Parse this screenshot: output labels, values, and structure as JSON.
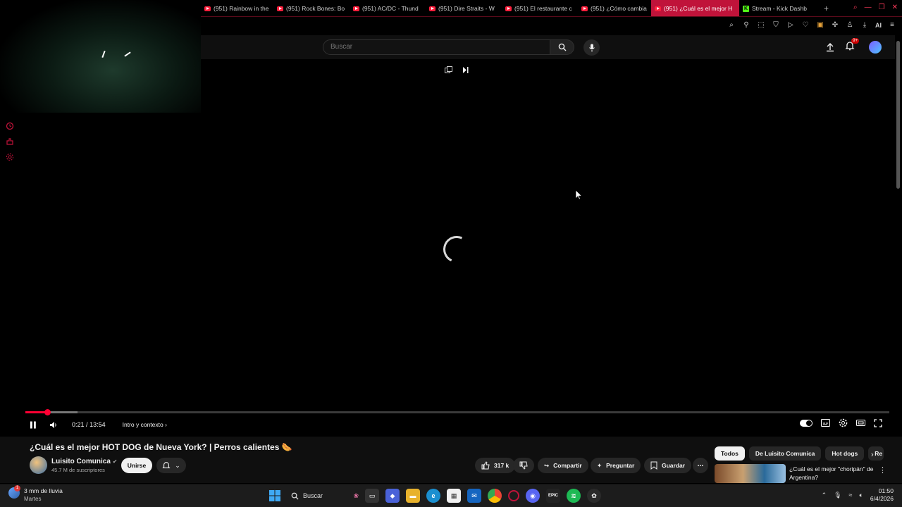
{
  "browser": {
    "tabs": [
      {
        "label": "(951) Rainbow in the",
        "type": "yt"
      },
      {
        "label": "(951) Rock Bones: Bo",
        "type": "yt"
      },
      {
        "label": "(951) AC/DC - Thund",
        "type": "yt"
      },
      {
        "label": "(951) Dire Straits - W",
        "type": "yt"
      },
      {
        "label": "(951) El restaurante c",
        "type": "yt"
      },
      {
        "label": "(951) ¿Cómo cambia",
        "type": "yt"
      },
      {
        "label": "(951) ¿Cuál es el mejor H",
        "type": "yt",
        "active": true
      },
      {
        "label": "Stream - Kick Dashb",
        "type": "kick"
      }
    ],
    "toolbar_ai": "AI",
    "accent": "#c0133a"
  },
  "youtube": {
    "search_placeholder": "Buscar",
    "notifications_badge": "9+"
  },
  "player": {
    "current_time": "0:21",
    "duration": "13:54",
    "time_separator": "/",
    "chapter": "Intro y contexto",
    "progress_fraction": 0.0252,
    "buffer_fraction": 0.06
  },
  "video": {
    "title": "¿Cuál es el mejor HOT DOG de Nueva York? | Perros calientes 🌭",
    "channel": "Luisito Comunica",
    "subscribers": "45.7 M de suscriptores",
    "join_label": "Unirse",
    "likes": "317 k",
    "share_label": "Compartir",
    "ask_label": "Preguntar",
    "save_label": "Guardar"
  },
  "sidebar_chips": [
    "Todos",
    "De Luisito Comunica",
    "Hot dogs",
    "Re"
  ],
  "recommendation": {
    "title": "¿Cuál es el mejor \"choripán\" de Argentina?"
  },
  "taskbar": {
    "weather_line1": "3 mm de lluvia",
    "weather_line2": "Martes",
    "search_label": "Buscar",
    "time": "01:50",
    "date": "6/4/2026"
  }
}
